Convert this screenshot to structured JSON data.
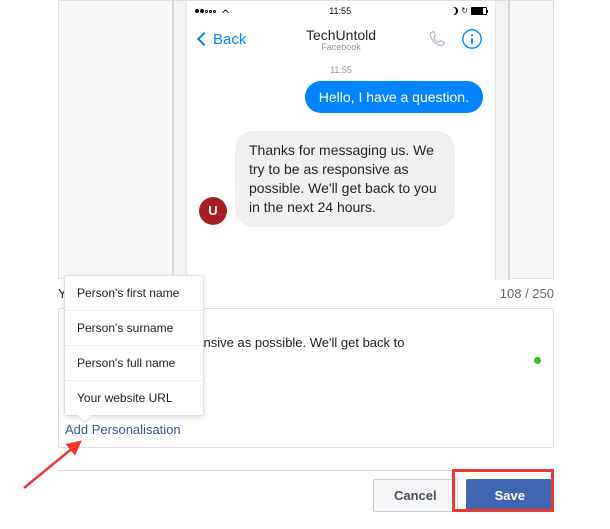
{
  "phone": {
    "statusbar": {
      "time": "11:55"
    },
    "nav": {
      "back_label": "Back",
      "title": "TechUntold",
      "subtitle": "Facebook"
    },
    "chat": {
      "timestamp": "11:55",
      "outgoing_message": "Hello, I have a question.",
      "incoming_message": "Thanks for messaging us. We try to be as responsive as possible. We'll get back to you in the next 24 hours.",
      "avatar_letter": "U"
    }
  },
  "counter": {
    "label_prefix": "Y",
    "current": "108",
    "sep": " / ",
    "max": "250"
  },
  "textbox": {
    "visible_text": ". We try to be as responsive as possible. We'll get back to",
    "add_personalisation": "Add Personalisation"
  },
  "dropdown": {
    "items": [
      "Person's first name",
      "Person's surname",
      "Person's full name",
      "Your website URL"
    ]
  },
  "buttons": {
    "cancel": "Cancel",
    "save": "Save"
  },
  "colors": {
    "messenger_blue": "#0084ff",
    "fb_blue": "#4267b2",
    "annotation_red": "#ed3833"
  }
}
